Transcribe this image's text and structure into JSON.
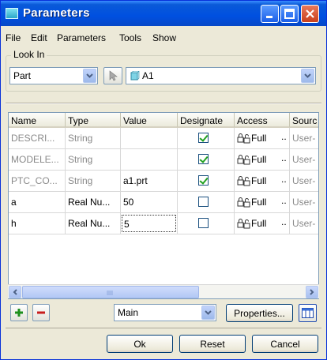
{
  "window": {
    "title": "Parameters"
  },
  "menu": [
    "File",
    "Edit",
    "Parameters",
    "Tools",
    "Show"
  ],
  "look_in": {
    "label": "Look In",
    "type_value": "Part",
    "object_value": "A1"
  },
  "table": {
    "columns": [
      "Name",
      "Type",
      "Value",
      "Designate",
      "Access",
      "Sourc"
    ],
    "rows": [
      {
        "name": "DESCRI...",
        "type": "String",
        "value": "",
        "designate": true,
        "access": "Full",
        "source": "User-",
        "dimmed": true
      },
      {
        "name": "MODELE...",
        "type": "String",
        "value": "",
        "designate": true,
        "access": "Full",
        "source": "User-",
        "dimmed": true
      },
      {
        "name": "PTC_CO...",
        "type": "String",
        "value": "a1.prt",
        "designate": true,
        "access": "Full",
        "source": "User-",
        "dimmed": true
      },
      {
        "name": "a",
        "type": "Real Nu...",
        "value": "50",
        "designate": false,
        "access": "Full",
        "source": "User-",
        "dimmed": false
      },
      {
        "name": "h",
        "type": "Real Nu...",
        "value": "5",
        "designate": false,
        "access": "Full",
        "source": "User-",
        "dimmed": false,
        "editing": true
      }
    ]
  },
  "bottom": {
    "filter_value": "Main",
    "properties_label": "Properties...",
    "ok_label": "Ok",
    "reset_label": "Reset",
    "cancel_label": "Cancel"
  },
  "colors": {
    "titlebar": "#0050e0",
    "face": "#ece9d8",
    "check": "#21a121"
  }
}
